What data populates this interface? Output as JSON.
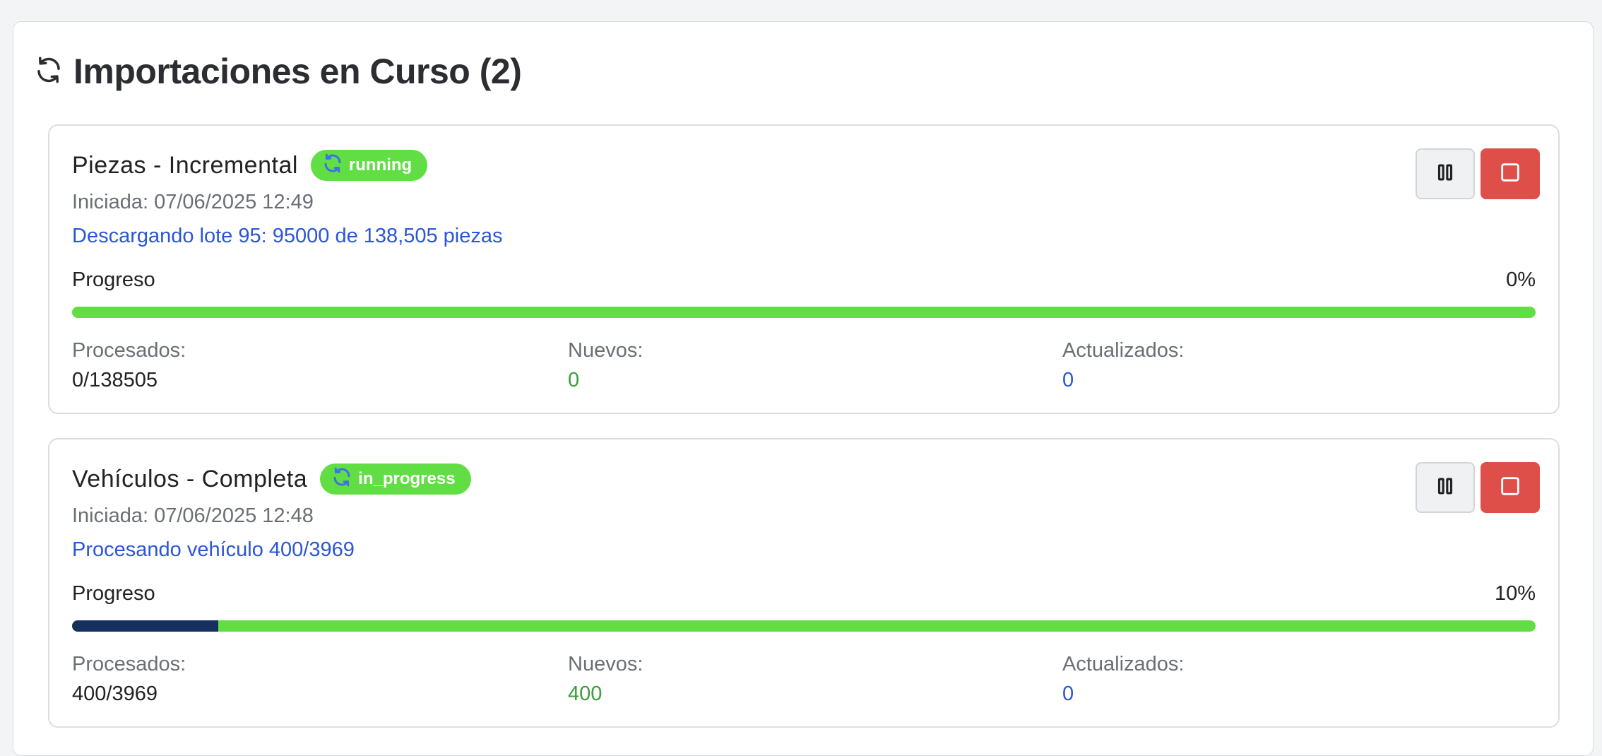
{
  "header": {
    "title": "Importaciones en Curso (2)",
    "icon": "refresh-icon"
  },
  "colors": {
    "badge_green": "#62de45",
    "progress_fill": "#15305f",
    "stop_red": "#df4f4a",
    "link_blue": "#2a56d8",
    "new_green": "#3a9e3a"
  },
  "jobs": [
    {
      "name": "Piezas - Incremental",
      "status": "running",
      "started": "Iniciada: 07/06/2025 12:49",
      "message": "Descargando lote 95: 95000 de 138,505 piezas",
      "progress_label": "Progreso",
      "progress_pct": "0%",
      "progress_value": 0,
      "processed_label": "Procesados:",
      "processed_value": "0/138505",
      "new_label": "Nuevos:",
      "new_value": "0",
      "updated_label": "Actualizados:",
      "updated_value": "0",
      "pause_icon": "pause-icon",
      "stop_icon": "stop-icon"
    },
    {
      "name": "Vehículos - Completa",
      "status": "in_progress",
      "started": "Iniciada: 07/06/2025 12:48",
      "message": "Procesando vehículo 400/3969",
      "progress_label": "Progreso",
      "progress_pct": "10%",
      "progress_value": 10,
      "processed_label": "Procesados:",
      "processed_value": "400/3969",
      "new_label": "Nuevos:",
      "new_value": "400",
      "updated_label": "Actualizados:",
      "updated_value": "0",
      "pause_icon": "pause-icon",
      "stop_icon": "stop-icon"
    }
  ]
}
